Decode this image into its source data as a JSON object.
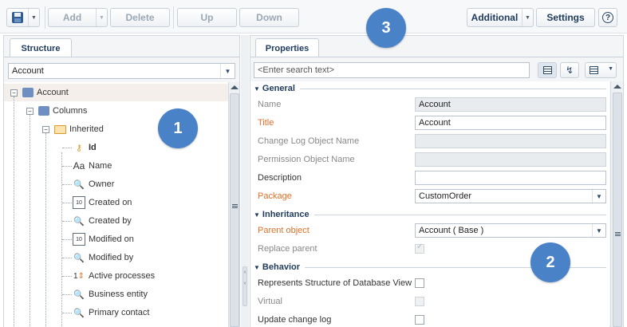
{
  "toolbar": {
    "add_label": "Add",
    "delete_label": "Delete",
    "up_label": "Up",
    "down_label": "Down",
    "additional_label": "Additional",
    "settings_label": "Settings",
    "help_label": "?"
  },
  "structure": {
    "tab_label": "Structure",
    "combo_value": "Account",
    "tree": {
      "root": "Account",
      "columns": "Columns",
      "inherited": "Inherited",
      "items": [
        "Id",
        "Name",
        "Owner",
        "Created on",
        "Created by",
        "Modified on",
        "Modified by",
        "Active processes",
        "Business entity",
        "Primary contact"
      ]
    }
  },
  "properties": {
    "tab_label": "Properties",
    "search_placeholder": "<Enter search text>",
    "general": {
      "header": "General",
      "name_label": "Name",
      "name_value": "Account",
      "title_label": "Title",
      "title_value": "Account",
      "changelog_label": "Change Log Object Name",
      "permission_label": "Permission Object Name",
      "description_label": "Description",
      "package_label": "Package",
      "package_value": "CustomOrder"
    },
    "inheritance": {
      "header": "Inheritance",
      "parent_label": "Parent object",
      "parent_value": "Account ( Base )",
      "replace_label": "Replace parent"
    },
    "behavior": {
      "header": "Behavior",
      "represents_label": "Represents Structure of Database View",
      "virtual_label": "Virtual",
      "update_log_label": "Update change log"
    }
  },
  "callouts": {
    "one": "1",
    "two": "2",
    "three": "3"
  },
  "colors": {
    "accent": "#4a82c8",
    "required_label": "#e0702a",
    "header_text": "#1f3b5c"
  }
}
